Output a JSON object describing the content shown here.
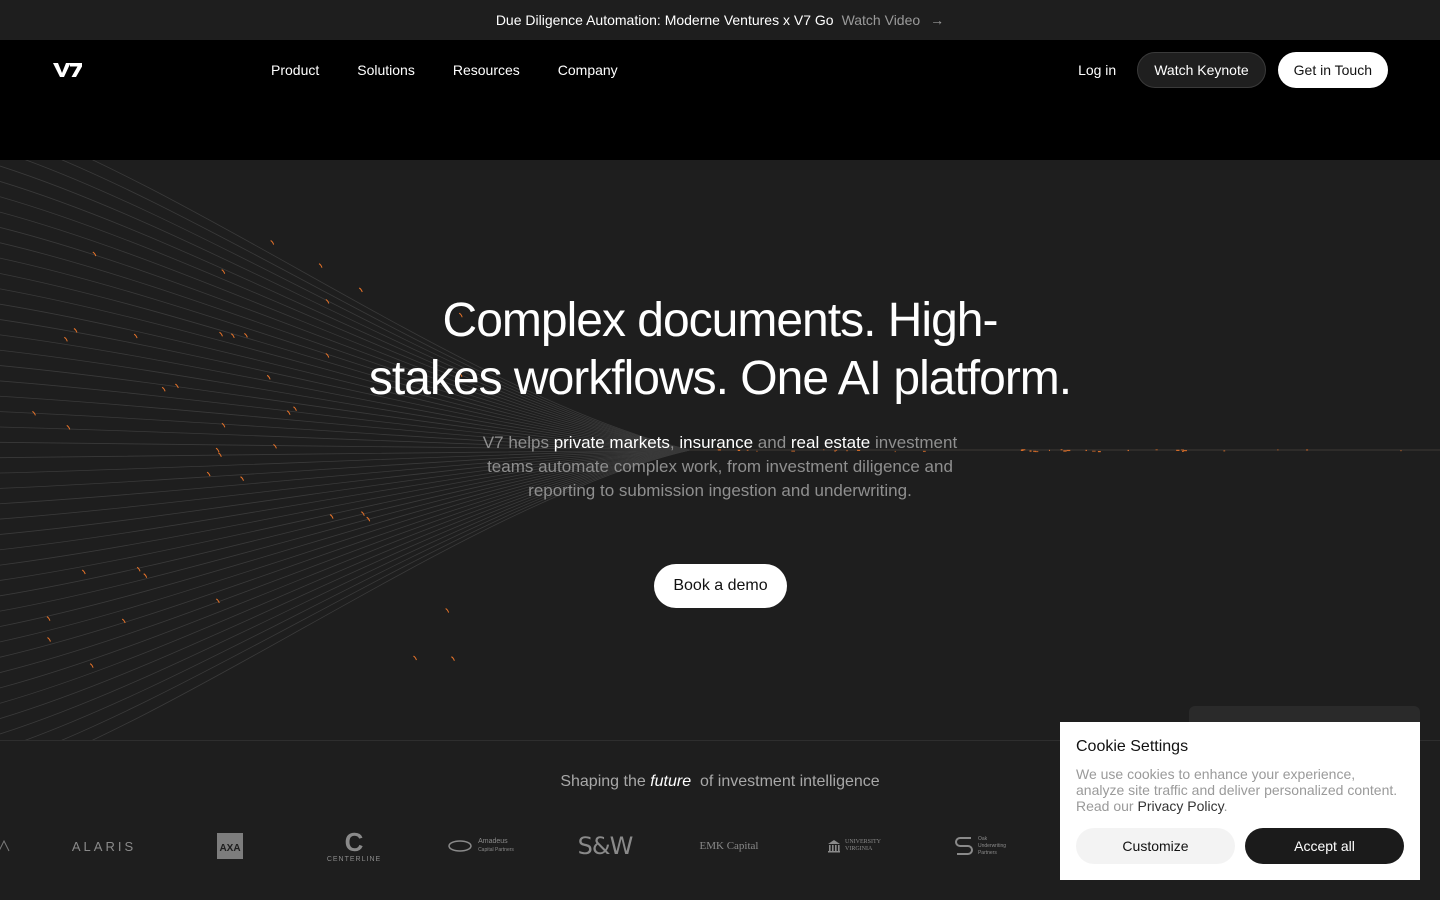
{
  "announcement": {
    "text": "Due Diligence Automation: Moderne Ventures x V7 Go",
    "link": "Watch Video",
    "arrow": "→"
  },
  "nav": {
    "logo": "V7",
    "items": [
      {
        "label": "Product"
      },
      {
        "label": "Solutions"
      },
      {
        "label": "Resources"
      },
      {
        "label": "Company"
      }
    ],
    "login": "Log in",
    "keynote": "Watch Keynote",
    "contact": "Get in Touch"
  },
  "hero": {
    "title_line1": "Complex documents. High-",
    "title_line2": "stakes workflows. One AI platform.",
    "sub": {
      "p1": "V7 helps ",
      "h1": "private markets",
      "p2": ", ",
      "h2": "insurance",
      "p3": " and ",
      "h3": "real estate",
      "p4": " investment teams automate complex work, from investment diligence and reporting to submission ingestion and underwriting."
    },
    "cta": "Book a demo",
    "accent_color": "#e8742a"
  },
  "logos": {
    "heading_pre": "Shaping the ",
    "heading_em": "future",
    "heading_post": "  of investment intelligence",
    "items": [
      {
        "name": "ALARIS"
      },
      {
        "name": "AXA"
      },
      {
        "name": "CENTERLINE"
      },
      {
        "name": "Amadeus"
      },
      {
        "name": "S&W"
      },
      {
        "name": "EMK Capital"
      },
      {
        "name": "UNIVERSITY VIRGINIA"
      },
      {
        "name": "Oak Underwriting Partners"
      }
    ],
    "centerline_mark": "C",
    "amadeus_sub": "Capital Partners",
    "uva_top": "UNIVERSITY",
    "uva_bottom": "VIRGINIA",
    "oak_lines": [
      "Oak",
      "Underwriting",
      "Partners"
    ]
  },
  "cookie": {
    "title": "Cookie Settings",
    "body": "We use cookies to enhance your experience, analyze site traffic and deliver personalized content. Read our ",
    "policy": "Privacy Policy",
    "period": ".",
    "customize": "Customize",
    "accept": "Accept all"
  }
}
